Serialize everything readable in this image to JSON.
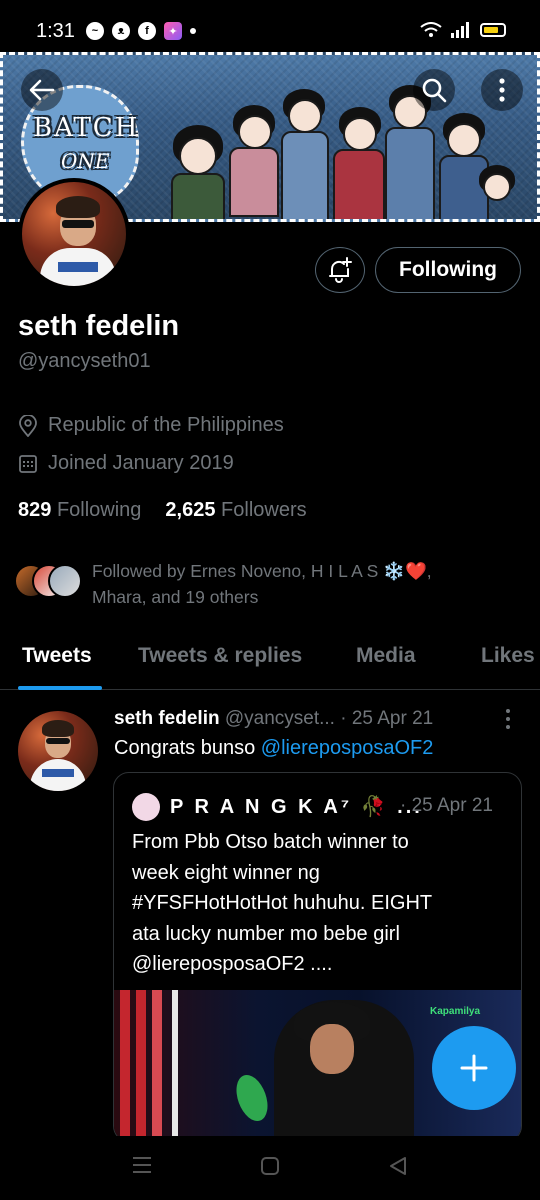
{
  "status_bar": {
    "time": "1:31"
  },
  "colors": {
    "accent": "#1d9bf0",
    "background": "#000000",
    "secondary_text": "#71767b"
  },
  "banner": {
    "title": "BATCH",
    "subtitle": "ONE"
  },
  "actions": {
    "following_label": "Following"
  },
  "profile": {
    "display_name": "seth fedelin",
    "handle": "@yancyseth01",
    "location": "Republic of the Philippines",
    "joined": "Joined January 2019",
    "following_count": "829",
    "following_label": "Following",
    "followers_count": "2,625",
    "followers_label": "Followers",
    "followed_by_line1": "Followed by Ernes Noveno, H I L A S ❄️❤️,",
    "followed_by_line2": "Mhara, and 19 others"
  },
  "tabs": [
    {
      "label": "Tweets",
      "active": true
    },
    {
      "label": "Tweets & replies",
      "active": false
    },
    {
      "label": "Media",
      "active": false
    },
    {
      "label": "Likes",
      "active": false
    }
  ],
  "tweet": {
    "name": "seth fedelin",
    "handle": "@yancyset...",
    "date": "· 25 Apr 21",
    "text": "Congrats bunso ",
    "mention": "@liereposposaOF2",
    "quote": {
      "name": "P R A N G K A⁷ 🥀 ...",
      "date": "· 25 Apr 21",
      "line1": "From Pbb Otso batch winner to",
      "line2": "week eight winner ng",
      "line3": "#YFSFHotHotHot huhuhu. EIGHT",
      "line4": "ata lucky number mo bebe girl",
      "line5": "@liereposposaOF2 ....",
      "media_badge": "Kapamilya"
    }
  }
}
